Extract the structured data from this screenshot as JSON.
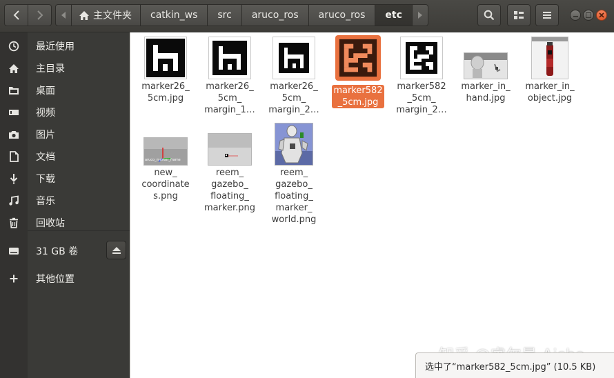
{
  "path": {
    "home_label": "主文件夹",
    "crumbs": [
      "catkin_ws",
      "src",
      "aruco_ros",
      "aruco_ros",
      "etc"
    ]
  },
  "sidebar": {
    "items": [
      {
        "label": "最近使用",
        "icon": "clock-icon"
      },
      {
        "label": "主目录",
        "icon": "home-icon"
      },
      {
        "label": "桌面",
        "icon": "folder-icon"
      },
      {
        "label": "视频",
        "icon": "video-icon"
      },
      {
        "label": "图片",
        "icon": "camera-icon"
      },
      {
        "label": "文档",
        "icon": "document-icon"
      },
      {
        "label": "下载",
        "icon": "download-icon"
      },
      {
        "label": "音乐",
        "icon": "music-icon"
      },
      {
        "label": "回收站",
        "icon": "trash-icon"
      },
      {
        "label": "31 GB 卷",
        "icon": "drive-icon"
      },
      {
        "label": "其他位置",
        "icon": "plus-icon"
      }
    ]
  },
  "files": [
    {
      "name": "marker26_\n5cm.jpg",
      "selected": false
    },
    {
      "name": "marker26_\n5cm_\nmargin_1…",
      "selected": false
    },
    {
      "name": "marker26_\n5cm_\nmargin_2…",
      "selected": false
    },
    {
      "name": "marker582\n_5cm.jpg",
      "selected": true
    },
    {
      "name": "marker582\n_5cm_\nmargin_2…",
      "selected": false
    },
    {
      "name": "marker_in_\nhand.jpg",
      "selected": false
    },
    {
      "name": "marker_in_\nobject.jpg",
      "selected": false
    },
    {
      "name": "new_\ncoordinate\ns.png",
      "selected": false
    },
    {
      "name": "reem_\ngazebo_\nfloating_\nmarker.png",
      "selected": false
    },
    {
      "name": "reem_\ngazebo_\nfloating_\nmarker_\nworld.png",
      "selected": false
    }
  ],
  "thumb_texts": {
    "new_coordinates_caption": "aruco_marker_frame"
  },
  "status": {
    "text": "选中了“marker582_5cm.jpg” (10.5 KB)"
  },
  "watermark": "知乎 @睿尔曼 Aisha",
  "colors": {
    "accent": "#e9713f",
    "header": "#3d3c38",
    "sidebar": "#3a3a37"
  }
}
